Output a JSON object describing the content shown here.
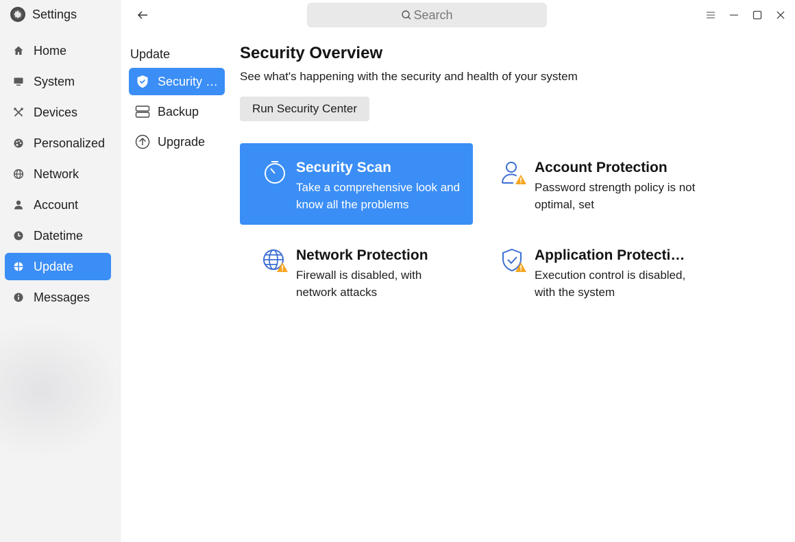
{
  "app": {
    "title": "Settings"
  },
  "search": {
    "placeholder": "Search"
  },
  "sidebar": {
    "items": [
      {
        "label": "Home",
        "icon": "home-icon"
      },
      {
        "label": "System",
        "icon": "monitor-icon"
      },
      {
        "label": "Devices",
        "icon": "tools-icon"
      },
      {
        "label": "Personalized",
        "icon": "palette-icon"
      },
      {
        "label": "Network",
        "icon": "globe-icon"
      },
      {
        "label": "Account",
        "icon": "user-icon"
      },
      {
        "label": "Datetime",
        "icon": "clock-icon"
      },
      {
        "label": "Update",
        "icon": "update-icon",
        "active": true
      },
      {
        "label": "Messages",
        "icon": "info-icon"
      }
    ]
  },
  "subnav": {
    "title": "Update",
    "items": [
      {
        "label": "Security C…",
        "icon": "shield-icon",
        "active": true
      },
      {
        "label": "Backup",
        "icon": "backup-icon"
      },
      {
        "label": "Upgrade",
        "icon": "upgrade-icon"
      }
    ]
  },
  "main": {
    "title": "Security Overview",
    "subtitle": "See what's happening with the security and health of your system",
    "run_button": "Run Security Center",
    "cards": [
      {
        "title": "Security Scan",
        "desc": "Take a comprehensive look and know all the problems",
        "icon": "scan-timer-icon",
        "active": true
      },
      {
        "title": "Account Protection",
        "desc": "Password strength policy is not optimal, set",
        "icon": "account-warning-icon"
      },
      {
        "title": "Network Protection",
        "desc": "Firewall is disabled, with network attacks",
        "icon": "globe-warning-icon"
      },
      {
        "title": "Application Protecti…",
        "desc": "Execution control is disabled, with the system",
        "icon": "shield-check-warning-icon"
      }
    ]
  },
  "colors": {
    "accent": "#3b8ef5",
    "warning": "#f5a623",
    "icon_blue": "#3d6fd4"
  }
}
